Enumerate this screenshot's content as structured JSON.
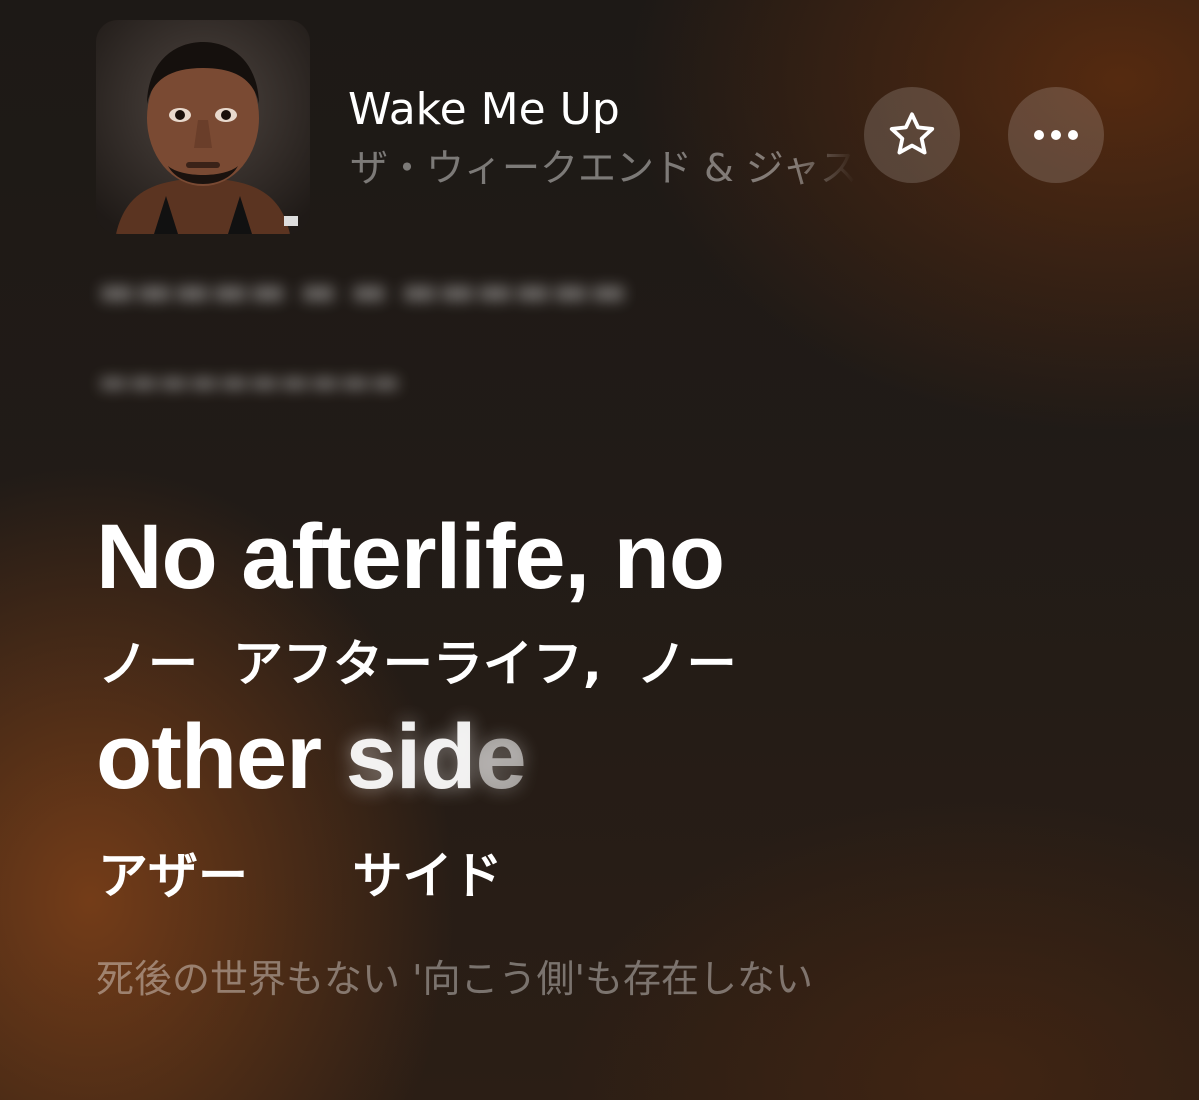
{
  "now_playing": {
    "title": "Wake Me Up",
    "artist": "ザ・ウィークエンド & ジャスティス",
    "artwork_icon": "album-artwork",
    "favorite_icon": "star-icon",
    "more_icon": "ellipsis-icon"
  },
  "lyrics": {
    "line1_en": "No afterlife,  no",
    "line1_kana": "ノー  アフターライフ,  ノー",
    "line2_en_sung": "other ",
    "line2_en_singing": "sid",
    "line2_en_upcoming": "e",
    "line2_kana": "アザー      サイド",
    "translation": "死後の世界もない '向こう側'も存在しない"
  },
  "colors": {
    "accent_brown": "#783e18",
    "background_dark": "#1d1916"
  }
}
